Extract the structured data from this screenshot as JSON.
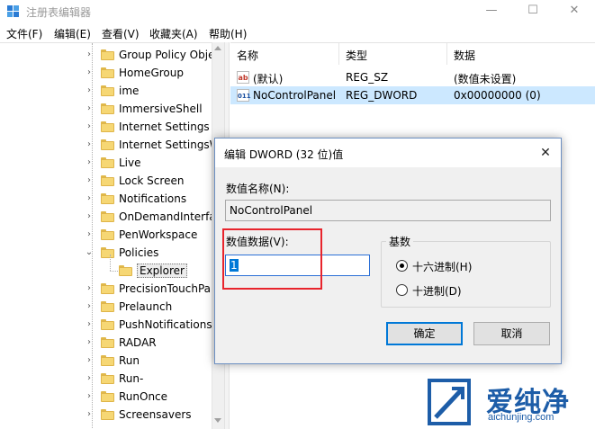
{
  "window": {
    "title": "注册表编辑器"
  },
  "menu": [
    "文件(F)",
    "编辑(E)",
    "查看(V)",
    "收藏夹(A)",
    "帮助(H)"
  ],
  "tree": {
    "items": [
      {
        "label": "Group Policy Obje",
        "expandable": true
      },
      {
        "label": "HomeGroup",
        "expandable": true
      },
      {
        "label": "ime",
        "expandable": true
      },
      {
        "label": "ImmersiveShell",
        "expandable": true
      },
      {
        "label": "Internet Settings",
        "expandable": true
      },
      {
        "label": "Internet SettingsW",
        "expandable": true
      },
      {
        "label": "Live",
        "expandable": true
      },
      {
        "label": "Lock Screen",
        "expandable": true
      },
      {
        "label": "Notifications",
        "expandable": true
      },
      {
        "label": "OnDemandInterfa",
        "expandable": true
      },
      {
        "label": "PenWorkspace",
        "expandable": true
      },
      {
        "label": "Policies",
        "expandable": true,
        "expanded": true
      },
      {
        "label": "Explorer",
        "expandable": false,
        "child": true,
        "selected": true
      },
      {
        "label": "PrecisionTouchPa",
        "expandable": true
      },
      {
        "label": "Prelaunch",
        "expandable": true
      },
      {
        "label": "PushNotifications",
        "expandable": true
      },
      {
        "label": "RADAR",
        "expandable": true
      },
      {
        "label": "Run",
        "expandable": true
      },
      {
        "label": "Run-",
        "expandable": true
      },
      {
        "label": "RunOnce",
        "expandable": true
      },
      {
        "label": "Screensavers",
        "expandable": true
      }
    ]
  },
  "list": {
    "columns": [
      "名称",
      "类型",
      "数据"
    ],
    "rows": [
      {
        "icon": "ab",
        "name": "(默认)",
        "type": "REG_SZ",
        "data": "(数值未设置)",
        "selected": false
      },
      {
        "icon": "011",
        "name": "NoControlPanel",
        "type": "REG_DWORD",
        "data": "0x00000000 (0)",
        "selected": true
      }
    ]
  },
  "dialog": {
    "title": "编辑 DWORD (32 位)值",
    "value_name_label": "数值名称(N):",
    "value_name": "NoControlPanel",
    "value_data_label": "数值数据(V):",
    "value_data": "1",
    "base_label": "基数",
    "radio_hex": "十六进制(H)",
    "radio_dec": "十进制(D)",
    "base_selected": "hex",
    "ok_label": "确定",
    "cancel_label": "取消",
    "close_glyph": "✕"
  },
  "watermark": {
    "name": "爱纯净",
    "url": "aichunjing.com"
  },
  "colors": {
    "accent": "#0078d7",
    "selection": "#cce8ff",
    "highlight": "#e8242c",
    "brand": "#1d5da8"
  }
}
